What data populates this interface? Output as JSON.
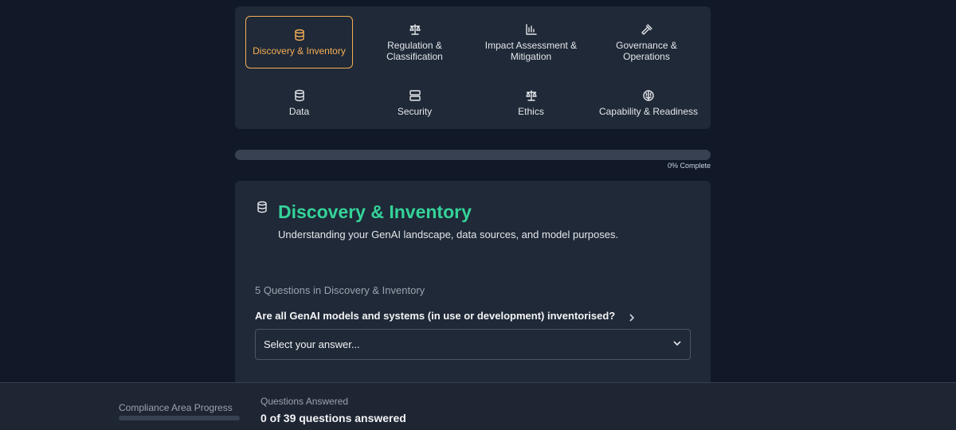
{
  "categories": [
    {
      "label": "Discovery & Inventory",
      "icon": "database-icon",
      "active": true
    },
    {
      "label": "Regulation & Classification",
      "icon": "scale-icon",
      "active": false
    },
    {
      "label": "Impact Assessment & Mitigation",
      "icon": "bar-chart-icon",
      "active": false
    },
    {
      "label": "Governance & Operations",
      "icon": "gavel-icon",
      "active": false
    },
    {
      "label": "Data",
      "icon": "database-icon",
      "active": false
    },
    {
      "label": "Security",
      "icon": "server-icon",
      "active": false
    },
    {
      "label": "Ethics",
      "icon": "scale-icon",
      "active": false
    },
    {
      "label": "Capability & Readiness",
      "icon": "brain-icon",
      "active": false
    }
  ],
  "progress": {
    "percent": 0,
    "label": "0% Complete"
  },
  "section": {
    "icon": "database-icon",
    "title": "Discovery & Inventory",
    "subtitle": "Understanding your GenAI landscape, data sources, and model purposes.",
    "question_count": "5 Questions in Discovery & Inventory",
    "question": "Are all GenAI models and systems (in use or development) inventorised?",
    "select_placeholder": "Select your answer..."
  },
  "footer": {
    "area_label": "Compliance Area Progress",
    "area_percent": 0,
    "answered_label": "Questions Answered",
    "answered_value": "0 of 39 questions answered"
  },
  "colors": {
    "accent": "#f6ad55",
    "title": "#34d399",
    "background": "#111827",
    "card": "#1f2937"
  }
}
